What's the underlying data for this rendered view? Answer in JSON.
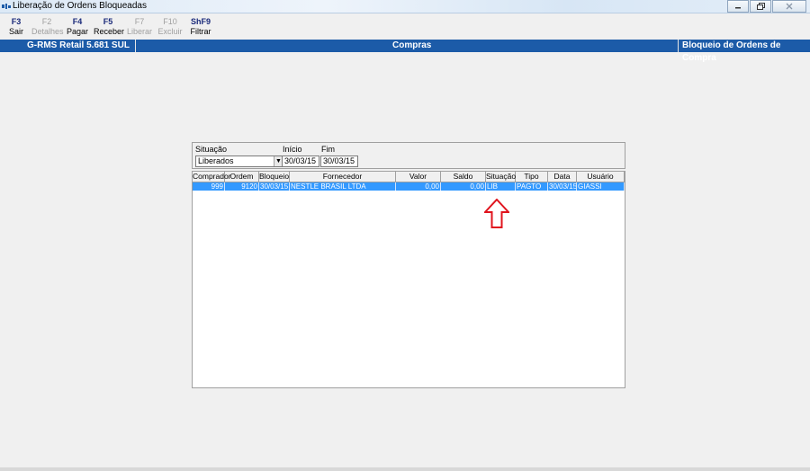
{
  "window": {
    "title": "Liberação de Ordens Bloqueadas",
    "controls": [
      "minimize",
      "restore",
      "close"
    ]
  },
  "toolbar": {
    "buttons": [
      {
        "key": "F3",
        "label": "Sair",
        "enabled": true
      },
      {
        "key": "F2",
        "label": "Detalhes",
        "enabled": false
      },
      {
        "key": "F4",
        "label": "Pagar",
        "enabled": true
      },
      {
        "key": "F5",
        "label": "Receber",
        "enabled": true
      },
      {
        "key": "F7",
        "label": "Liberar",
        "enabled": false
      },
      {
        "key": "F10",
        "label": "Excluir",
        "enabled": false
      },
      {
        "key": "ShF9",
        "label": "Filtrar",
        "enabled": true
      }
    ]
  },
  "banner": {
    "app": "G-RMS Retail 5.681 SUL",
    "module": "Compras",
    "screen": "Bloqueio de Ordens de Compra",
    "color": "#1c5ba8"
  },
  "filters": {
    "situacao_label": "Situação",
    "situacao_value": "Liberados",
    "inicio_label": "Início",
    "inicio_value": "30/03/15",
    "fim_label": "Fim",
    "fim_value": "30/03/15"
  },
  "grid": {
    "columns": [
      "Comprador",
      "Ordem",
      "Bloqueio",
      "Fornecedor",
      "Valor",
      "Saldo",
      "Situação",
      "Tipo",
      "Data",
      "Usuário"
    ],
    "rows": [
      {
        "comprador": "999",
        "ordem": "9120",
        "bloqueio": "30/03/15",
        "fornecedor": "NESTLE BRASIL LTDA",
        "valor": "0,00",
        "saldo": "0,00",
        "situacao": "LIB",
        "tipo": "PAGTO",
        "data": "30/03/15",
        "usuario": "GIASSI"
      }
    ],
    "selected_row_color": "#3399ff"
  },
  "annotation": {
    "icon": "up-arrow-outline",
    "color": "#e0141e"
  }
}
